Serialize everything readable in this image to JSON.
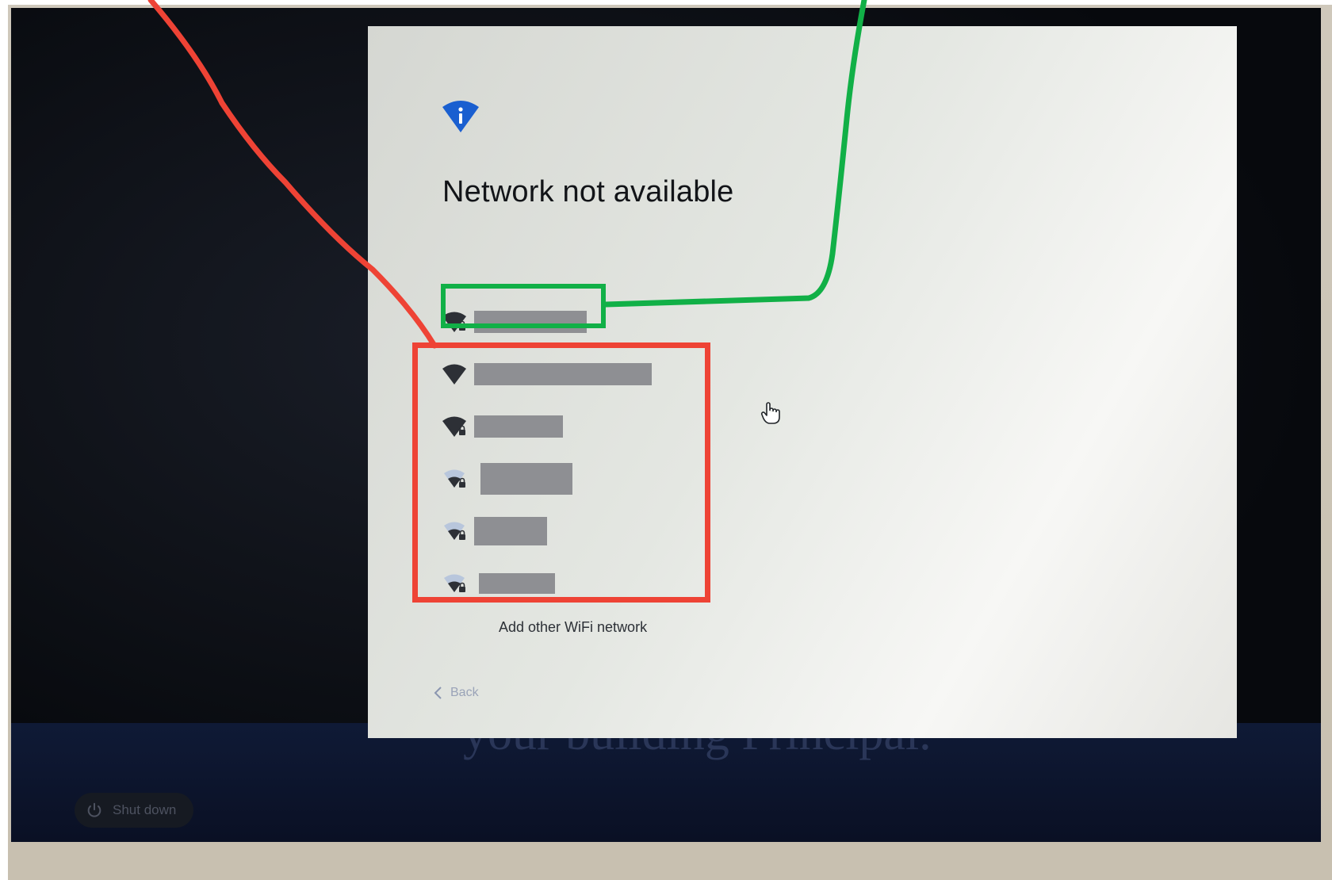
{
  "dialog": {
    "title": "Network not available",
    "add_network_label": "Add other WiFi network",
    "back_label": "Back"
  },
  "networks": [
    {
      "name": "",
      "signal": "strong",
      "secured": true
    },
    {
      "name": "",
      "signal": "strong",
      "secured": false
    },
    {
      "name": "",
      "signal": "strong",
      "secured": true
    },
    {
      "name": "",
      "signal": "weak",
      "secured": true
    },
    {
      "name": "",
      "signal": "weak",
      "secured": true
    },
    {
      "name": "",
      "signal": "weak",
      "secured": true
    }
  ],
  "background_text": "your building Principal.",
  "shutdown_label": "Shut down",
  "colors": {
    "info_icon": "#1a5fd0",
    "annotation_green": "#11b047",
    "annotation_red": "#ee4335"
  }
}
